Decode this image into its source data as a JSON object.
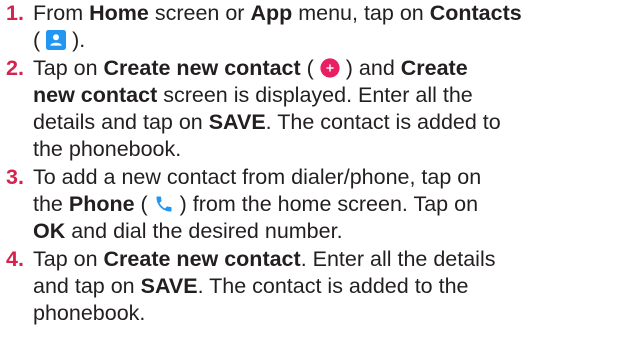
{
  "steps": [
    {
      "number": "1.",
      "parts": [
        {
          "t": "From "
        },
        {
          "t": "Home",
          "b": true
        },
        {
          "t": " screen or "
        },
        {
          "t": "App",
          "b": true
        },
        {
          "t": " menu, tap on "
        },
        {
          "t": "Contacts",
          "b": true
        },
        {
          "br": true
        },
        {
          "t": "( "
        },
        {
          "icon": "contacts-icon"
        },
        {
          "t": " )."
        }
      ]
    },
    {
      "number": "2.",
      "parts": [
        {
          "t": "Tap on "
        },
        {
          "t": "Create new contact",
          "b": true
        },
        {
          "t": " ( "
        },
        {
          "icon": "add-contact-icon"
        },
        {
          "t": " ) and "
        },
        {
          "t": "Create",
          "b": true
        },
        {
          "br": true
        },
        {
          "t": "new contact",
          "b": true
        },
        {
          "t": " screen is displayed. Enter all the"
        },
        {
          "br": true
        },
        {
          "t": "details and tap on "
        },
        {
          "t": "SAVE",
          "b": true
        },
        {
          "t": ". The contact is added to"
        },
        {
          "br": true
        },
        {
          "t": "the phonebook."
        }
      ]
    },
    {
      "number": "3.",
      "parts": [
        {
          "t": "To add a new contact from dialer/phone, tap on"
        },
        {
          "br": true
        },
        {
          "t": "the "
        },
        {
          "t": "Phone",
          "b": true
        },
        {
          "t": " ( "
        },
        {
          "icon": "phone-icon"
        },
        {
          "t": " ) from the home screen. Tap on"
        },
        {
          "br": true
        },
        {
          "t": "OK",
          "b": true
        },
        {
          "t": " and dial the desired number."
        }
      ]
    },
    {
      "number": "4.",
      "parts": [
        {
          "t": "Tap on "
        },
        {
          "t": "Create new contact",
          "b": true
        },
        {
          "t": ". Enter all the details"
        },
        {
          "br": true
        },
        {
          "t": "and tap on "
        },
        {
          "t": "SAVE",
          "b": true
        },
        {
          "t": ". The contact is added to the"
        },
        {
          "br": true
        },
        {
          "t": "phonebook."
        }
      ]
    }
  ],
  "colors": {
    "step_number": "#d6224f",
    "body_text": "#231f20",
    "contacts_icon_bg": "#2196f3",
    "add_contact_icon_bg": "#e91e63",
    "phone_icon_color": "#2196f3"
  }
}
